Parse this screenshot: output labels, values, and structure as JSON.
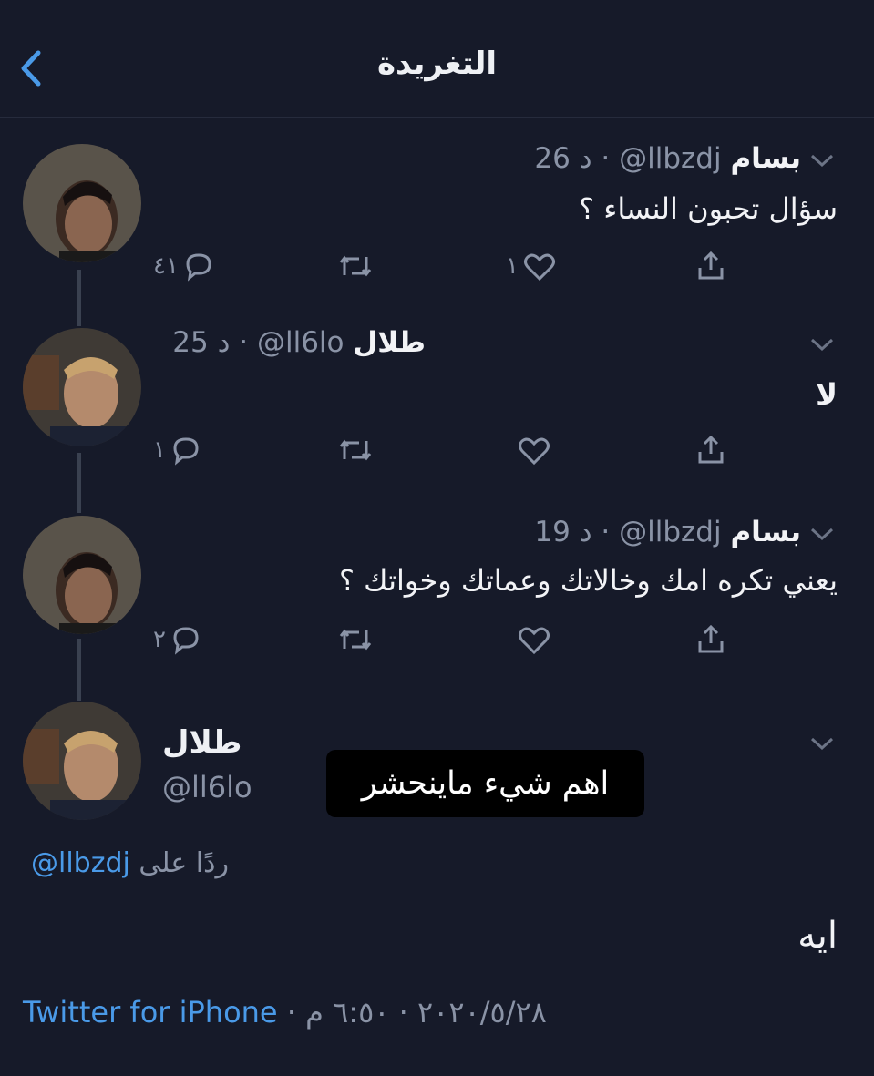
{
  "header": {
    "title": "التغريدة"
  },
  "tweets": [
    {
      "name": "بسام",
      "handle": "@llbzdj",
      "time": "26 د",
      "text": "سؤال تحبون النساء ؟",
      "replies": "٤١",
      "retweets": "",
      "likes": "١"
    },
    {
      "name": "طلال",
      "handle": "@ll6lo",
      "time": "25 د",
      "text": "لا",
      "replies": "١",
      "retweets": "",
      "likes": ""
    },
    {
      "name": "بسام",
      "handle": "@llbzdj",
      "time": "19 د",
      "text": "يعني تكره امك وخالاتك وعماتك وخواتك ؟",
      "replies": "٢",
      "retweets": "",
      "likes": ""
    }
  ],
  "main_tweet": {
    "name": "طلال",
    "handle": "@ll6lo",
    "replying_to_label": "ردًا على",
    "replying_to_handle": "@llbzdj",
    "text": "ايه",
    "source": "Twitter for iPhone",
    "date": "٢٠٢٠/٥/٢٨",
    "time": "٦:٥٠ م",
    "separator": "·"
  },
  "overlay_caption": "اهم شيء ماينحشر",
  "colors": {
    "background": "#161a29",
    "muted": "#8a93a6",
    "link": "#4a9ae8",
    "thread_line": "#3a4150"
  },
  "icons": [
    "chevron-left-icon",
    "chevron-down-icon",
    "reply-icon",
    "retweet-icon",
    "like-icon",
    "share-icon"
  ]
}
